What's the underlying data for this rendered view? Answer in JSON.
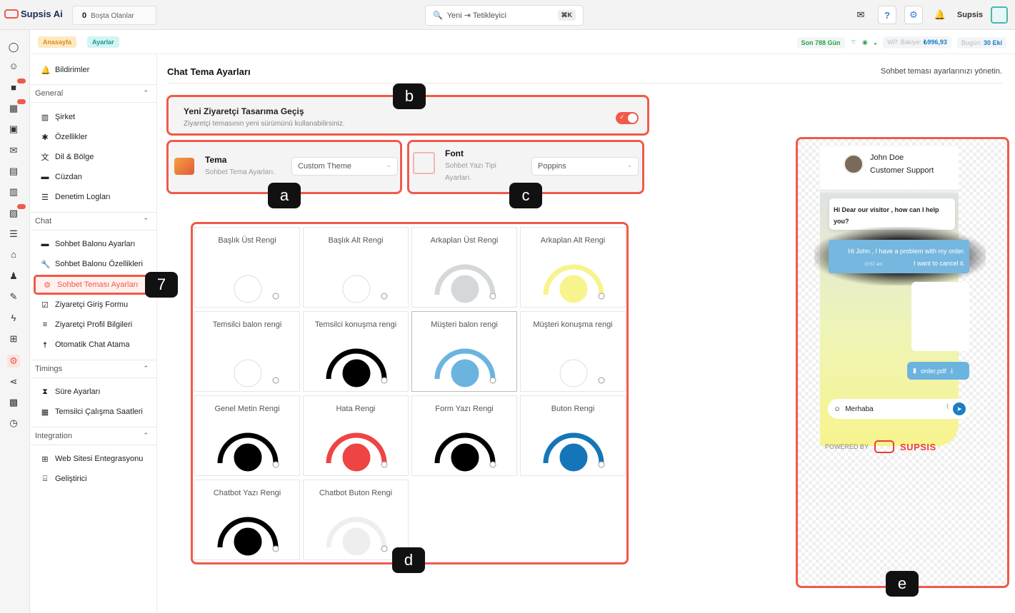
{
  "topbar": {
    "app_name": "Supsis Ai",
    "idle_count": "0",
    "idle_label": "Boşta Olanlar",
    "search_placeholder": "Yeni ⇥ Tetikleyici",
    "shortcut": "⌘K",
    "user_name": "Supsis"
  },
  "breadcrumb": {
    "home": "Anasayfa",
    "current": "Ayarlar"
  },
  "stats": {
    "days": "Son 788 Gün",
    "balance_label": "WP. Bakiye:",
    "balance_value": "₺996,93",
    "today_label": "Bugün:",
    "today_value": "30 Eki"
  },
  "sidebar": {
    "top_item": "Bildirimler",
    "general_title": "General",
    "general_items": [
      "Şirket",
      "Özellikler",
      "Dil & Bölge",
      "Cüzdan",
      "Denetim Logları"
    ],
    "chat_title": "Chat",
    "chat_items": [
      "Sohbet Balonu Ayarları",
      "Sohbet Balonu Özellikleri",
      "Sohbet Teması Ayarları",
      "Ziyaretçi Giriş Formu",
      "Ziyaretçi Profil Bilgileri",
      "Otomatik Chat Atama"
    ],
    "timings_title": "Timings",
    "timings_items": [
      "Süre Ayarları",
      "Temsilci Çalışma Saatleri"
    ],
    "integration_title": "Integration",
    "integration_items": [
      "Web Sitesi Entegrasyonu",
      "Geliştirici"
    ]
  },
  "page": {
    "title": "Chat Tema Ayarları",
    "description": "Sohbet teması ayarlarınızı yönetin."
  },
  "visitor_toggle": {
    "title": "Yeni Ziyaretçi Tasarıma Geçiş",
    "description": "Ziyaretçi temasının yeni sürümünü kullanabilirsiniz.",
    "enabled": true
  },
  "theme": {
    "title": "Tema",
    "subtitle": "Sohbet Tema Ayarları.",
    "value": "Custom Theme"
  },
  "font": {
    "title": "Font",
    "subtitle_1": "Sohbet Yazı Tipi",
    "subtitle_2": "Ayarları.",
    "value": "Poppins"
  },
  "color_cells": [
    {
      "label": "Başlık Üst Rengi",
      "color": "#ffffff"
    },
    {
      "label": "Başlık Alt Rengi",
      "color": "#ffffff"
    },
    {
      "label": "Arkaplan Üst Rengi",
      "color": "#d5d8da"
    },
    {
      "label": "Arkaplan Alt Rengi",
      "color": "#f7f48e"
    },
    {
      "label": "Temsilci balon rengi",
      "color": "#ffffff"
    },
    {
      "label": "Temsilci konuşma rengi",
      "color": "#000000"
    },
    {
      "label": "Müşteri balon rengi",
      "color": "#6cb4e0"
    },
    {
      "label": "Müşteri konuşma rengi",
      "color": "#ffffff"
    },
    {
      "label": "Genel Metin Rengi",
      "color": "#000000"
    },
    {
      "label": "Hata Rengi",
      "color": "#ef4444"
    },
    {
      "label": "Form Yazı Rengi",
      "color": "#000000"
    },
    {
      "label": "Buton Rengi",
      "color": "#1476b8"
    },
    {
      "label": "Chatbot Yazı Rengi",
      "color": "#000000"
    },
    {
      "label": "Chatbot Buton Rengi",
      "color": "#eeeeee"
    }
  ],
  "preview": {
    "agent_name": "John Doe",
    "agent_role": "Customer Support",
    "agent_msg_1": "Hi Dear our visitor , how can I help",
    "agent_msg_2": "you?",
    "visitor_msg_1": "Hi John , I have a problem with my order.",
    "visitor_msg_2": "I want to cancel it.",
    "visitor_time": "10:57 am",
    "file_name": "order.pdf",
    "input_value": "Merhaba",
    "powered_by": "POWERED BY",
    "brand": "SUPSIS"
  },
  "annotations": {
    "a": "a",
    "b": "b",
    "c": "c",
    "d": "d",
    "e": "e",
    "step": "7"
  },
  "colors": {
    "accent": "#ef5a4a",
    "badge": "#111111"
  }
}
